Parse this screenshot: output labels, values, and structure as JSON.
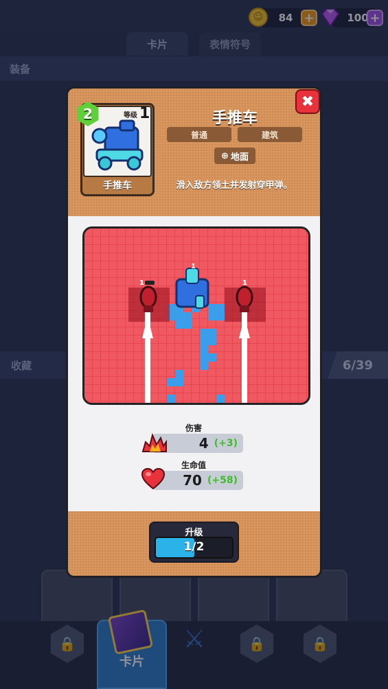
{
  "currency": {
    "coins": "84",
    "gems": "100",
    "coin_symbol": "☺",
    "plus_symbol": "+"
  },
  "tabs": [
    {
      "label": "卡片"
    },
    {
      "label": "表情符号"
    }
  ],
  "sections": {
    "equipment": "装备",
    "collection": "收藏",
    "collection_count": "6/39"
  },
  "nav": {
    "active_label": "卡片",
    "items": [
      "lock",
      "cards",
      "battle",
      "lock",
      "lock"
    ]
  },
  "modal": {
    "close_symbol": "✖",
    "card": {
      "name": "手推车",
      "level_badge": "2",
      "level_label": "等级",
      "level_value": "1"
    },
    "title": "手推车",
    "tags": [
      "普通",
      "建筑"
    ],
    "target": "地面",
    "target_icon": "target-icon",
    "description": "滑入敌方领土并发射穿甲弹。",
    "preview": {
      "units": [
        {
          "label": "1"
        },
        {
          "label": "1"
        },
        {
          "label": "1"
        }
      ]
    },
    "stats": [
      {
        "label": "伤害",
        "value": "4",
        "increase": "(+3)",
        "icon": "fire-icon"
      },
      {
        "label": "生命值",
        "value": "70",
        "increase": "(+58)",
        "icon": "heart-icon"
      }
    ],
    "upgrade": {
      "label": "升级",
      "progress_text": "1/2",
      "progress_fraction": 0.5
    }
  },
  "colors": {
    "accent_orange": "#d8955e",
    "close_red": "#e8333d",
    "increase_green": "#3fbd2c",
    "progress_blue": "#2bb3e9",
    "field_red": "#e8454e",
    "field_blue": "#3b9eea"
  }
}
